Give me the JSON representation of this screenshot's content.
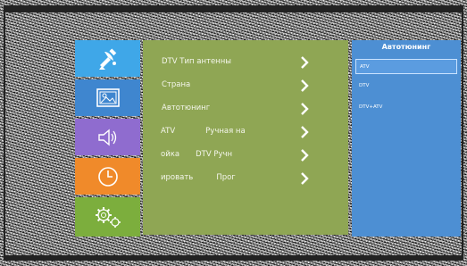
{
  "icon_column": [
    {
      "name": "satellite-icon",
      "color": "#3fa7e8"
    },
    {
      "name": "picture-icon",
      "color": "#3f86cf"
    },
    {
      "name": "sound-icon",
      "color": "#8f6ccf"
    },
    {
      "name": "clock-icon",
      "color": "#f08a2a"
    },
    {
      "name": "settings-icon",
      "color": "#7cae3d"
    }
  ],
  "menu": {
    "items": [
      {
        "label": "DTV Тип антенны",
        "label2": ""
      },
      {
        "label": "Страна",
        "label2": ""
      },
      {
        "label": "Автотюнинг",
        "label2": ""
      },
      {
        "label": "ATV",
        "label2": "Ручная на"
      },
      {
        "label": "ойка",
        "label2": "DTV Ручн"
      },
      {
        "label": "ировать",
        "label2": "Прог"
      }
    ]
  },
  "submenu": {
    "title": "Автотюнинг",
    "items": [
      {
        "label": "ATV",
        "selected": true
      },
      {
        "label": "DTV",
        "selected": false
      },
      {
        "label": "DTV+ATV",
        "selected": false
      }
    ]
  },
  "colors": {
    "menu_bg": "#8fa654",
    "submenu_bg": "#4d8fd3",
    "selection_border": "#c9e2ff"
  }
}
